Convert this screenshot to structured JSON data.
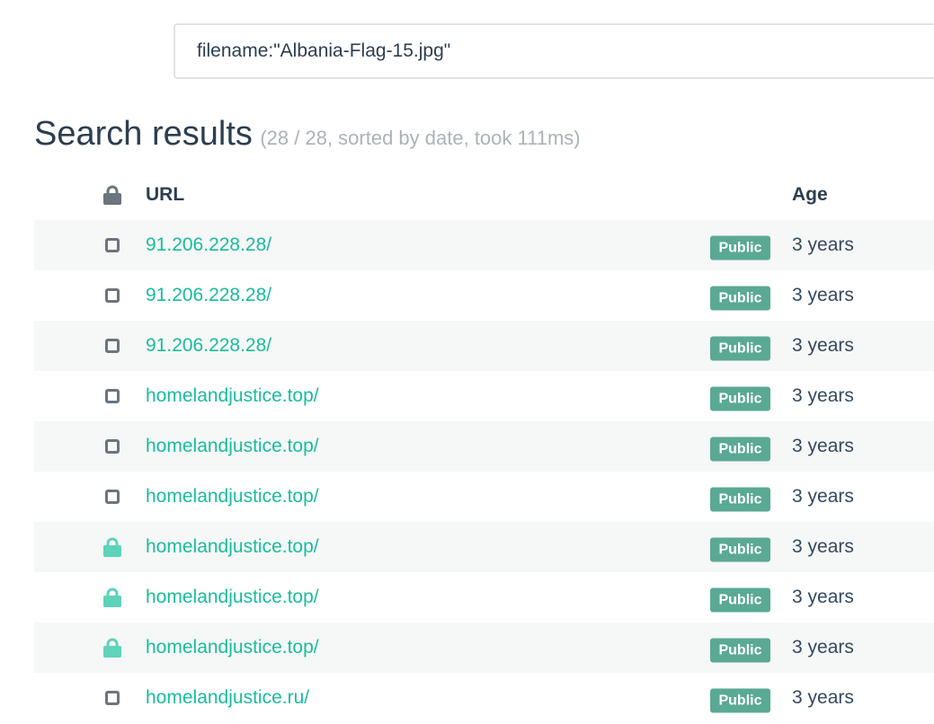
{
  "search": {
    "value": "filename:\"Albania-Flag-15.jpg\""
  },
  "results": {
    "title": "Search results",
    "meta": "(28 / 28, sorted by date, took 111ms)"
  },
  "table": {
    "header": {
      "lock_icon": "lock-icon",
      "url_label": "URL",
      "age_label": "Age"
    },
    "rows": [
      {
        "icon": "checkbox-icon",
        "url": "91.206.228.28/",
        "badge": "Public",
        "age": "3 years"
      },
      {
        "icon": "checkbox-icon",
        "url": "91.206.228.28/",
        "badge": "Public",
        "age": "3 years"
      },
      {
        "icon": "checkbox-icon",
        "url": "91.206.228.28/",
        "badge": "Public",
        "age": "3 years"
      },
      {
        "icon": "checkbox-icon",
        "url": "homelandjustice.top/",
        "badge": "Public",
        "age": "3 years"
      },
      {
        "icon": "checkbox-icon",
        "url": "homelandjustice.top/",
        "badge": "Public",
        "age": "3 years"
      },
      {
        "icon": "checkbox-icon",
        "url": "homelandjustice.top/",
        "badge": "Public",
        "age": "3 years"
      },
      {
        "icon": "lock-icon",
        "url": "homelandjustice.top/",
        "badge": "Public",
        "age": "3 years"
      },
      {
        "icon": "lock-icon",
        "url": "homelandjustice.top/",
        "badge": "Public",
        "age": "3 years"
      },
      {
        "icon": "lock-icon",
        "url": "homelandjustice.top/",
        "badge": "Public",
        "age": "3 years"
      },
      {
        "icon": "checkbox-icon",
        "url": "homelandjustice.ru/",
        "badge": "Public",
        "age": "3 years"
      }
    ]
  },
  "colors": {
    "link": "#1abc9c",
    "badge": "#5aa995",
    "lock_active": "#5fd3b9",
    "lock_header": "#6c757d",
    "text": "#2c3e50"
  }
}
